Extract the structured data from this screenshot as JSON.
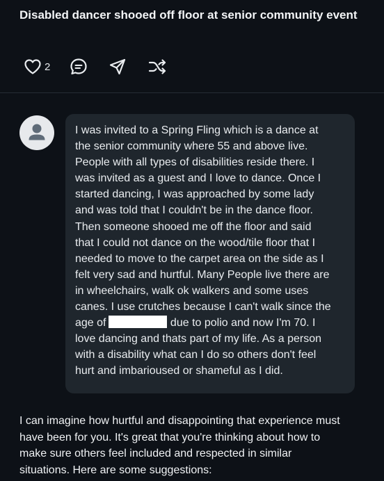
{
  "post": {
    "title": "Disabled dancer shooed off floor at senior community event",
    "like_count": "2"
  },
  "icons": {
    "like": "heart-icon",
    "comment": "comment-icon",
    "share": "send-icon",
    "remix": "shuffle-icon",
    "avatar": "user-avatar-icon"
  },
  "message": {
    "lines_part1": "I was invited to a Spring Fling which is a dance at\nthe senior community where 55 and above live.\nPeople with all types of disabilities reside there. I\nwas invited as a guest and I  love to dance. Once I\nstarted dancing, I was approached by some lady\nand was told that I  couldn't be in the dance floor.\nThen someone shooed me off the floor and said\nthat I could not dance on the wood/tile floor that I\nneeded to move to the carpet area on the side as I\nfelt very sad and hurtful. Many People live there are\nin wheelchairs, walk ok walkers and some uses\ncanes. I use crutches because I can't walk since the\nage of",
    "after_redaction": " due to polio and now I'm 70. I",
    "lines_part2": "love dancing and thats part of my life. As a person\nwith a disability what can I do so others don't feel\nhurt and imbarioused or shameful as I did."
  },
  "reply": {
    "text": "I can imagine how hurtful and disappointing that experience must\nhave been for you. It's great that you're thinking about how to\nmake sure others feel included and respected in similar\nsituations. Here are some suggestions:"
  },
  "colors": {
    "background": "#0d1117",
    "bubble": "#1f262d",
    "avatar_bg": "#e7e9ec",
    "avatar_fg": "#5f6b78"
  }
}
